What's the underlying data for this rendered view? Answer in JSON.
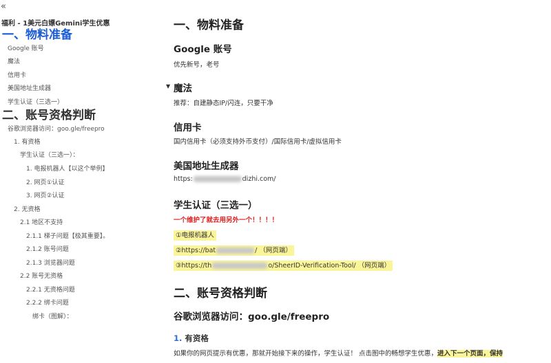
{
  "sidebar": {
    "collapse_icon": "«",
    "title": "福利 - 1美元白嫖Gemini学生优惠",
    "toc": [
      {
        "label": "一、物料准备"
      },
      {
        "label": "Google 账号"
      },
      {
        "label": "魔法"
      },
      {
        "label": "信用卡"
      },
      {
        "label": "美国地址生成器"
      },
      {
        "label": "学生认证（三选一）"
      },
      {
        "label": "二、账号资格判断"
      },
      {
        "label": "谷歌浏览器访问：goo.gle/freepro"
      },
      {
        "label": "1. 有资格"
      },
      {
        "label": "学生认证（三选一）："
      },
      {
        "label": "1. 电报机器人【以这个举例】"
      },
      {
        "label": "2. 网页①认证"
      },
      {
        "label": "3. 网页②认证"
      },
      {
        "label": "2. 无资格"
      },
      {
        "label": "2.1 地区不支持"
      },
      {
        "label": "2.1.1 梯子问题【极其重要】。"
      },
      {
        "label": "2.1.2 账号问题"
      },
      {
        "label": "2.1.3 浏览器问题"
      },
      {
        "label": "2.2 账号无资格"
      },
      {
        "label": "2.2.1 无资格问题"
      },
      {
        "label": "2.2.2 绑卡问题"
      },
      {
        "label": "绑卡（图解）："
      }
    ]
  },
  "content": {
    "section1_title": "一、物料准备",
    "google_title": "Google 账号",
    "google_text": "优先新号，老号",
    "magic_title": "魔法",
    "magic_text": "推荐：自建静态IP/闪连，只要干净",
    "card_title": "信用卡",
    "card_text": "国内信用卡（必须支持外币支付）/国际信用卡/虚拟信用卡",
    "addr_title": "美国地址生成器",
    "addr_prefix": "https:",
    "addr_suffix": "dizhi.com/",
    "student_title": "学生认证（三选一）",
    "student_warning": "一个维护了就去用另外一个！！！！",
    "opt1": "①电报机器人",
    "opt2_prefix": "②https://bat",
    "opt2_suffix": "/   （网页端）",
    "opt3_prefix": "③https://th",
    "opt3_suffix": "o/SheerID-Verification-Tool/   （网页端）",
    "section2_title": "二、账号资格判断",
    "visit_title": "谷歌浏览器访问：goo.gle/freepro",
    "eligible_num": "1.",
    "eligible_title": "有资格",
    "eligible_text": "如果你的网页提示有优惠，那就开始接下来的操作，学生认证！  点击图中的畅想学生优惠，",
    "eligible_highlight": "进入下一个页面，保持"
  }
}
